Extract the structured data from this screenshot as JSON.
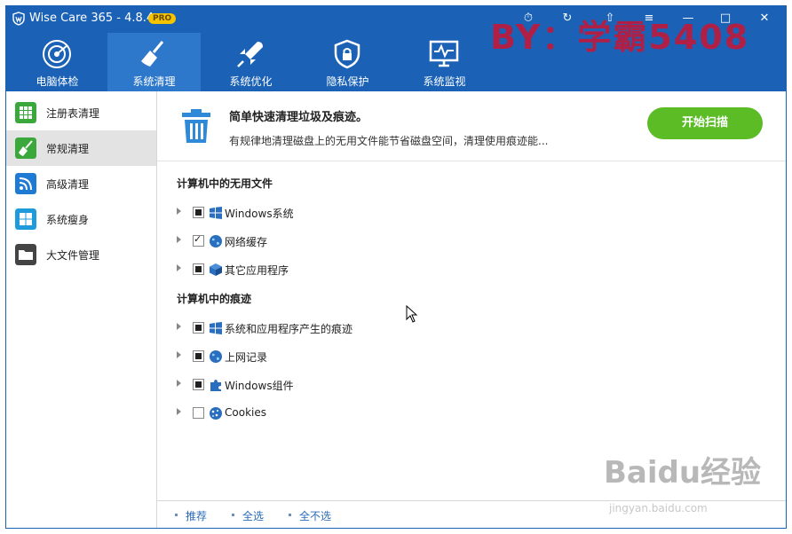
{
  "window": {
    "title": "Wise Care 365 - 4.8.4",
    "badge": "PRO",
    "watermark": "BY：学霸5408"
  },
  "nav": {
    "tabs": [
      {
        "label": "电脑体检",
        "icon": "radar-icon"
      },
      {
        "label": "系统清理",
        "icon": "broom-icon"
      },
      {
        "label": "系统优化",
        "icon": "rocket-icon"
      },
      {
        "label": "隐私保护",
        "icon": "shield-lock-icon"
      },
      {
        "label": "系统监视",
        "icon": "monitor-pulse-icon"
      }
    ],
    "active": "系统清理"
  },
  "sidebar": {
    "items": [
      {
        "label": "注册表清理",
        "color": "#3aa83a"
      },
      {
        "label": "常规清理",
        "color": "#3aa83a"
      },
      {
        "label": "高级清理",
        "color": "#1f7ad4"
      },
      {
        "label": "系统瘦身",
        "color": "#1f9bdc"
      },
      {
        "label": "大文件管理",
        "color": "#444444"
      }
    ],
    "active": "常规清理"
  },
  "header": {
    "title": "简单快速清理垃圾及痕迹。",
    "description": "有规律地清理磁盘上的无用文件能节省磁盘空间，清理使用痕迹能...",
    "scan_button": "开始扫描"
  },
  "sections": [
    {
      "title": "计算机中的无用文件",
      "items": [
        {
          "label": "Windows系统",
          "state": "partial",
          "icon": "windows-icon"
        },
        {
          "label": "网络缓存",
          "state": "checked",
          "icon": "globe-icon"
        },
        {
          "label": "其它应用程序",
          "state": "partial",
          "icon": "cube-icon"
        }
      ]
    },
    {
      "title": "计算机中的痕迹",
      "items": [
        {
          "label": "系统和应用程序产生的痕迹",
          "state": "partial",
          "icon": "windows-icon"
        },
        {
          "label": "上网记录",
          "state": "partial",
          "icon": "globe-icon"
        },
        {
          "label": "Windows组件",
          "state": "partial",
          "icon": "puzzle-icon"
        },
        {
          "label": "Cookies",
          "state": "unchecked",
          "icon": "cookie-icon"
        }
      ]
    }
  ],
  "footer": {
    "recommend": "推荐",
    "select_all": "全选",
    "select_none": "全不选"
  },
  "baidu": {
    "logo": "Baidu经验",
    "url": "jingyan.baidu.com"
  },
  "colors": {
    "titlebar": "#1b62b7",
    "active_tab": "#2e78cc",
    "scan": "#5cbc26",
    "link": "#2b6cb5"
  }
}
